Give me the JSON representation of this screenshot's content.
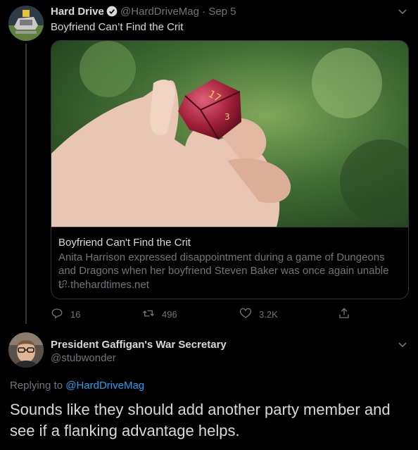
{
  "tweet": {
    "author_name": "Hard Drive",
    "author_handle": "@HardDriveMag",
    "separator": "·",
    "date": "Sep 5",
    "text": "Boyfriend Can’t Find the Crit",
    "card": {
      "title": "Boyfriend Can't Find the Crit",
      "description": "Anita Harrison expressed disappointment during a game of Dungeons and Dragons when her boyfriend Steven Baker was once again unable t...",
      "domain": "thehardtimes.net",
      "image_icon": "hand-holding-d20-photo"
    },
    "actions": {
      "replies": "16",
      "retweets": "496",
      "likes": "3.2K"
    }
  },
  "reply": {
    "author_name": "President Gaffigan's War Secretary",
    "author_handle": "@stubwonder",
    "replying_prefix": "Replying to",
    "replying_handle": "@HardDriveMag",
    "text": "Sounds like they should add another party member and see if a flanking advantage helps."
  },
  "colors": {
    "background": "#000000",
    "text": "#d9d9d9",
    "muted": "#6e767d",
    "accent": "#1da1f2",
    "border": "#2f3336"
  }
}
